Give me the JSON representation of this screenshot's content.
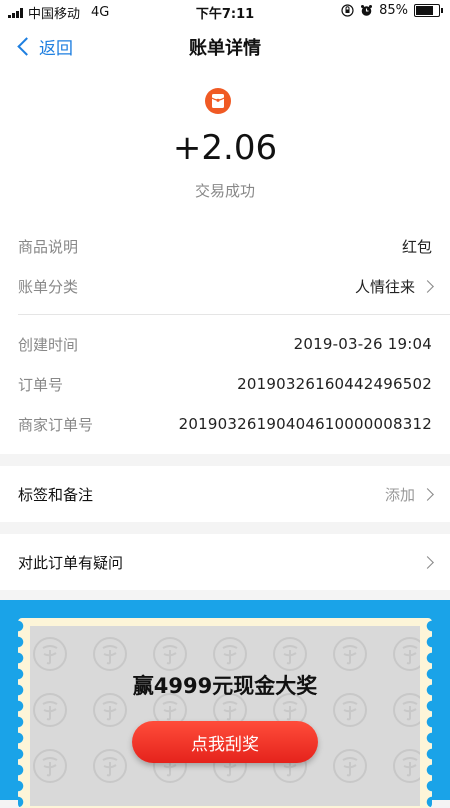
{
  "status_bar": {
    "carrier": "中国移动",
    "network": "4G",
    "time": "下午7:11",
    "battery": "85%",
    "battery_level": 0.85
  },
  "nav": {
    "back_label": "返回",
    "title": "账单详情"
  },
  "transaction": {
    "icon": "red-envelope-icon",
    "icon_color": "#f05a24",
    "amount": "+2.06",
    "status": "交易成功"
  },
  "details": [
    {
      "label": "商品说明",
      "value": "红包"
    },
    {
      "label": "账单分类",
      "value": "人情往来"
    },
    {
      "label": "创建时间",
      "value": "2019-03-26 19:04"
    },
    {
      "label": "订单号",
      "value": "20190326160442496502"
    },
    {
      "label": "商家订单号",
      "value": "20190326190404610000008312"
    }
  ],
  "tags": {
    "label": "标签和备注",
    "action": "添加"
  },
  "question": {
    "label": "对此订单有疑问"
  },
  "promo": {
    "title": "赢4999元现金大奖",
    "button": "点我刮奖",
    "background_color": "#1aa3e8",
    "button_color": "#e5231c"
  },
  "colors": {
    "accent": "#1e7fe0"
  }
}
